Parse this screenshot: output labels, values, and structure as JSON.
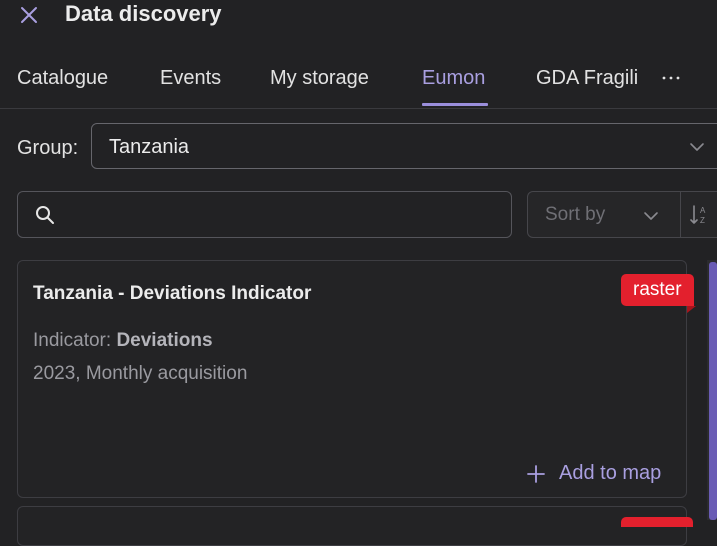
{
  "header": {
    "title": "Data discovery",
    "close_icon": "close-icon"
  },
  "tabs": [
    {
      "label": "Catalogue",
      "active": false
    },
    {
      "label": "Events",
      "active": false
    },
    {
      "label": "My storage",
      "active": false
    },
    {
      "label": "Eumon",
      "active": true
    },
    {
      "label": "GDA Fragili",
      "active": false
    }
  ],
  "tabs_more_icon": "more-horizontal-icon",
  "group": {
    "label": "Group:",
    "value": "Tanzania"
  },
  "search": {
    "placeholder": "",
    "value": ""
  },
  "sort": {
    "placeholder": "Sort by",
    "order_icon": "sort-alpha-ascending-icon"
  },
  "cards": [
    {
      "title": "Tanzania - Deviations Indicator",
      "badge": "raster",
      "indicator_prefix": "Indicator: ",
      "indicator_value": "Deviations",
      "acquisition": "2023, Monthly acquisition",
      "action_label": "Add to map"
    }
  ],
  "colors": {
    "background": "#222224",
    "accent": "#a99fe0",
    "badge_red": "#e3202d",
    "scrollbar": "#6a5cb5"
  }
}
